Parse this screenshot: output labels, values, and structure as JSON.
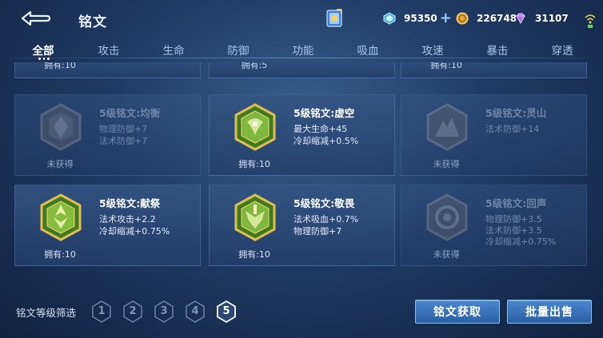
{
  "header": {
    "title": "铭文",
    "currencies": [
      {
        "icon": "diamond-coupon-icon",
        "value": "95350",
        "has_plus": true
      },
      {
        "icon": "gold-coin-icon",
        "value": "226748"
      },
      {
        "icon": "gem-icon",
        "value": "31107"
      }
    ]
  },
  "tabs": [
    {
      "label": "全部",
      "active": true
    },
    {
      "label": "攻击"
    },
    {
      "label": "生命"
    },
    {
      "label": "防御"
    },
    {
      "label": "功能"
    },
    {
      "label": "吸血"
    },
    {
      "label": "攻速"
    },
    {
      "label": "暴击"
    },
    {
      "label": "穿透"
    }
  ],
  "partial_row": [
    {
      "owned": "拥有:10"
    },
    {
      "owned": "拥有:5"
    },
    {
      "owned": "拥有:10"
    }
  ],
  "cards": [
    {
      "name": "5级铭文:均衡",
      "stats": [
        "物理防御+7",
        "法术防御+7"
      ],
      "bottom": "未获得",
      "locked": true,
      "badge": "balance-rune-icon"
    },
    {
      "name": "5级铭文:虚空",
      "stats": [
        "最大生命+45",
        "冷却缩减+0.5%"
      ],
      "bottom": "拥有:10",
      "locked": false,
      "badge": "void-rune-icon"
    },
    {
      "name": "5级铭文:灵山",
      "stats": [
        "法术防御+14"
      ],
      "bottom": "未获得",
      "locked": true,
      "badge": "spirit-mountain-rune-icon"
    },
    {
      "name": "5级铭文:献祭",
      "stats": [
        "法术攻击+2.2",
        "冷却缩减+0.75%"
      ],
      "bottom": "拥有:10",
      "locked": false,
      "badge": "sacrifice-rune-icon"
    },
    {
      "name": "5级铭文:敬畏",
      "stats": [
        "法术吸血+0.7%",
        "物理防御+7"
      ],
      "bottom": "拥有:10",
      "locked": false,
      "badge": "awe-rune-icon"
    },
    {
      "name": "5级铭文:回声",
      "stats": [
        "物理防御+3.5",
        "法术防御+3.5",
        "冷却缩减+0.75%"
      ],
      "bottom": "未获得",
      "locked": true,
      "badge": "echo-rune-icon"
    }
  ],
  "footer": {
    "filter_label": "铭文等级筛选",
    "levels": [
      "1",
      "2",
      "3",
      "4",
      "5"
    ],
    "active_level": "5",
    "obtain_label": "铭文获取",
    "sell_label": "批量出售"
  },
  "colors": {
    "accent_button": "#3a74bd",
    "rune_gold": "#d8b54a",
    "rune_green": "#5d9e32"
  }
}
